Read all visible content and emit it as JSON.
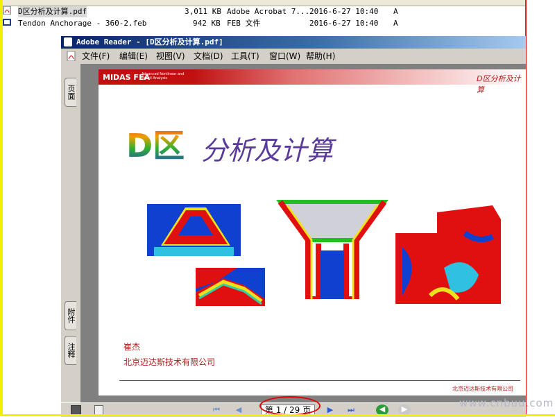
{
  "explorer": {
    "files": [
      {
        "name": "D区分析及计算.pdf",
        "size": "3,011 KB",
        "type": "Adobe Acrobat 7...",
        "modified": "2016-6-27 10:40",
        "attr": "A",
        "icon": "pdf-file-icon"
      },
      {
        "name": "Tendon Anchorage - 360-2.feb",
        "size": "942 KB",
        "type": "FEB 文件",
        "modified": "2016-6-27 10:40",
        "attr": "A",
        "icon": "feb-file-icon"
      }
    ]
  },
  "reader": {
    "title": "Adobe Reader - [D区分析及计算.pdf]",
    "menu": [
      "文件(F)",
      "编辑(E)",
      "视图(V)",
      "文档(D)",
      "工具(T)",
      "窗口(W)",
      "帮助(H)"
    ],
    "side_tabs": [
      "页面",
      "附件",
      "注释"
    ],
    "page_indicator": "第 1 / 29 页"
  },
  "document": {
    "logo_text": "MIDAS FEA",
    "logo_sub": "Advanced Nonlinear and Detail Analysis",
    "header_right": "D区分析及计算",
    "title_prefix": "D区",
    "title_main": "分析及计算",
    "author": "崔杰",
    "company": "北京迈达斯技术有限公司",
    "footer": "北京迈达斯技术有限公司"
  },
  "watermark": "www.cnbuu.com",
  "colors": {
    "accent": "#e0201e",
    "title_blue": "#0a246a",
    "doc_red": "#b01a1a",
    "title_purple": "#5a3a9a"
  }
}
